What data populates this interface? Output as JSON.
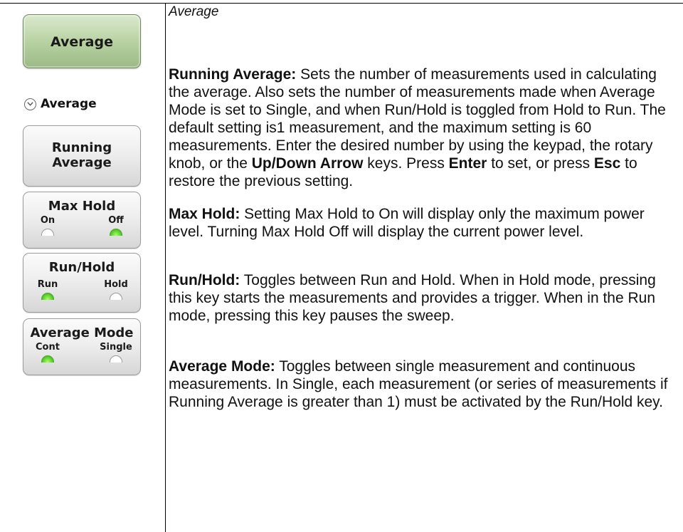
{
  "panel": {
    "menu_title": "Average",
    "submenu_label": "Average",
    "keys": {
      "running_average": "Running Average",
      "max_hold": {
        "label": "Max Hold",
        "opt1": "On",
        "opt2": "Off",
        "active": "Off"
      },
      "run_hold": {
        "label": "Run/Hold",
        "opt1": "Run",
        "opt2": "Hold",
        "active": "Run"
      },
      "average_mode": {
        "label": "Average Mode",
        "opt1": "Cont",
        "opt2": "Single",
        "active": "Cont"
      }
    }
  },
  "content": {
    "heading": "Average",
    "running_average": {
      "term": "Running Average:",
      "t1": "  Sets the number of measurements used in calculating the average. Also sets the number of measurements made when Average Mode is set to Single, and when Run/Hold is toggled from Hold to Run. The default setting is1 measurement, and the maximum setting is 60 measurements. Enter the desired number by using the keypad, the rotary knob, or the ",
      "b1": "Up/Down Arrow",
      "t2": " keys. Press ",
      "b2": "Enter",
      "t3": " to set, or press ",
      "b3": "Esc",
      "t4": " to restore the previous setting."
    },
    "max_hold": {
      "term": "Max Hold:",
      "text": "  Setting Max Hold to On will display only the maximum power level. Turning Max Hold Off will display the current power level."
    },
    "run_hold": {
      "term": "Run/Hold:",
      "text": "  Toggles between Run and Hold. When in Hold mode, pressing this key starts the measurements and provides a trigger. When in the Run mode, pressing this key pauses the sweep."
    },
    "average_mode": {
      "term": "Average Mode:",
      "text": "  Toggles between single measurement and continuous measurements. In Single, each measurement (or series of measurements if Running Average is greater than 1) must be activated by the Run/Hold key."
    }
  }
}
